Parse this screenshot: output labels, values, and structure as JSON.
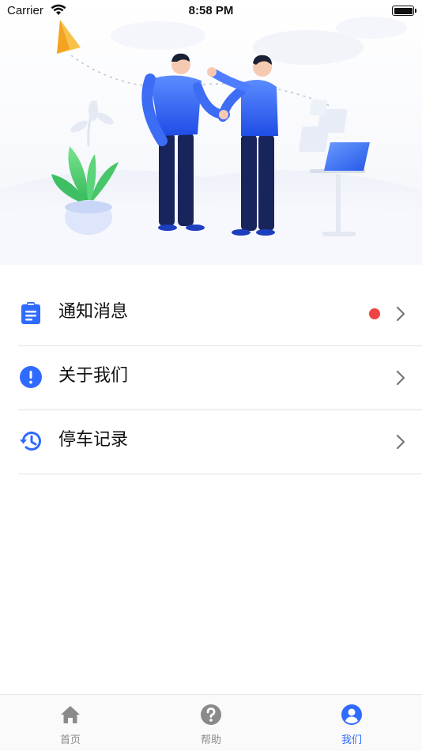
{
  "status_bar": {
    "carrier": "Carrier",
    "time": "8:58 PM"
  },
  "menu": {
    "items": [
      {
        "label": "通知消息",
        "icon": "clipboard-icon",
        "badge": true
      },
      {
        "label": "关于我们",
        "icon": "info-exclamation-icon",
        "badge": false
      },
      {
        "label": "停车记录",
        "icon": "history-icon",
        "badge": false
      }
    ]
  },
  "tab_bar": {
    "tabs": [
      {
        "label": "首页",
        "icon": "home-icon",
        "active": false
      },
      {
        "label": "帮助",
        "icon": "help-icon",
        "active": false
      },
      {
        "label": "我们",
        "icon": "user-icon",
        "active": true
      }
    ]
  },
  "colors": {
    "accent": "#2f6bff",
    "badge": "#ef4444",
    "inactive": "#8a8a8a",
    "divider": "#e2e2e2"
  }
}
